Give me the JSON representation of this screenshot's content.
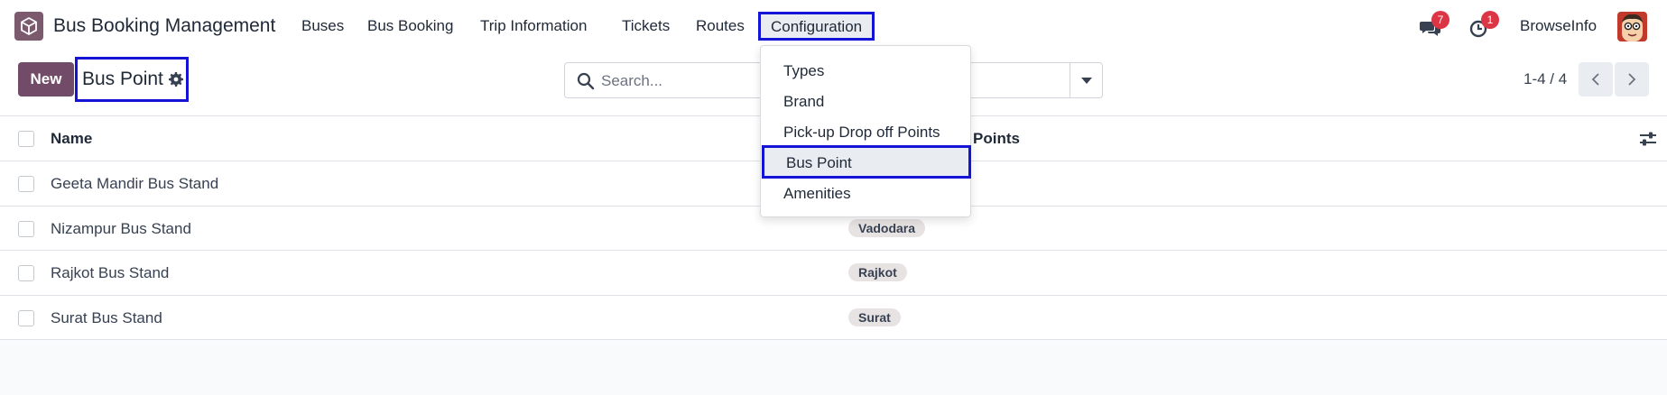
{
  "navbar": {
    "app_title": "Bus Booking Management",
    "menu": [
      {
        "label": "Buses"
      },
      {
        "label": "Bus Booking"
      },
      {
        "label": "Trip Information"
      },
      {
        "label": "Tickets"
      },
      {
        "label": "Routes"
      },
      {
        "label": "Configuration",
        "active": true
      }
    ],
    "messages_badge": "7",
    "activities_badge": "1",
    "company": "BrowseInfo"
  },
  "control_panel": {
    "new_label": "New",
    "breadcrumb": "Bus Point",
    "search_placeholder": "Search...",
    "pager": "1-4 / 4"
  },
  "config_menu": {
    "items": [
      {
        "label": "Types"
      },
      {
        "label": "Brand"
      },
      {
        "label": "Pick-up Drop off Points"
      },
      {
        "label": "Bus Point",
        "selected": true
      },
      {
        "label": "Amenities"
      }
    ]
  },
  "table": {
    "columns": {
      "name": "Name",
      "points": "Points"
    },
    "rows": [
      {
        "name": "Geeta Mandir Bus Stand",
        "tag": ""
      },
      {
        "name": "Nizampur Bus Stand",
        "tag": "Vadodara"
      },
      {
        "name": "Rajkot Bus Stand",
        "tag": "Rajkot"
      },
      {
        "name": "Surat Bus Stand",
        "tag": "Surat"
      }
    ]
  },
  "colors": {
    "primary": "#714b67",
    "highlight_border": "#1414d6",
    "badge": "#dc3545"
  },
  "icons": {
    "app_logo": "box-logo-icon",
    "messages": "chat-bubbles-icon",
    "activities": "clock-icon",
    "breadcrumb_settings": "gear-icon",
    "search": "search-icon",
    "search_options": "caret-down-icon",
    "pager_prev": "chevron-left-icon",
    "pager_next": "chevron-right-icon",
    "optional_columns": "sliders-icon"
  }
}
